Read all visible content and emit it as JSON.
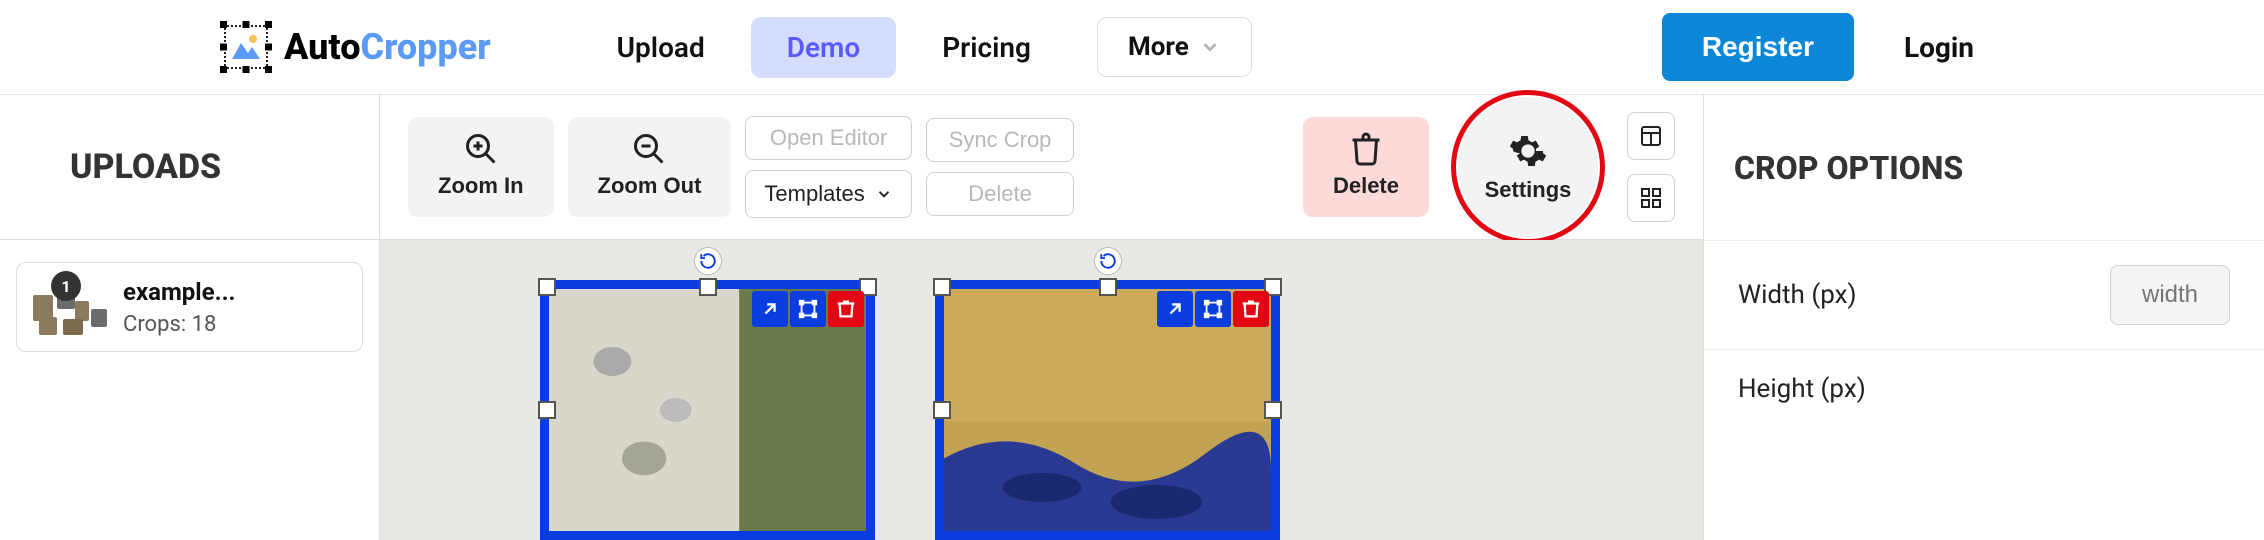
{
  "brand": {
    "part1": "Auto",
    "part2": "Cropper"
  },
  "nav": {
    "upload": "Upload",
    "demo": "Demo",
    "pricing": "Pricing",
    "more": "More",
    "register": "Register",
    "login": "Login"
  },
  "sidebar": {
    "title": "UPLOADS",
    "items": [
      {
        "badge": "1",
        "name": "example...",
        "crops_label": "Crops: 18"
      }
    ]
  },
  "toolbar": {
    "zoom_in": "Zoom In",
    "zoom_out": "Zoom Out",
    "open_editor": "Open Editor",
    "templates": "Templates",
    "sync_crop": "Sync Crop",
    "delete_disabled": "Delete",
    "delete": "Delete",
    "settings": "Settings"
  },
  "options": {
    "title": "CROP OPTIONS",
    "width_label": "Width (px)",
    "width_placeholder": "width",
    "height_label": "Height (px)"
  }
}
